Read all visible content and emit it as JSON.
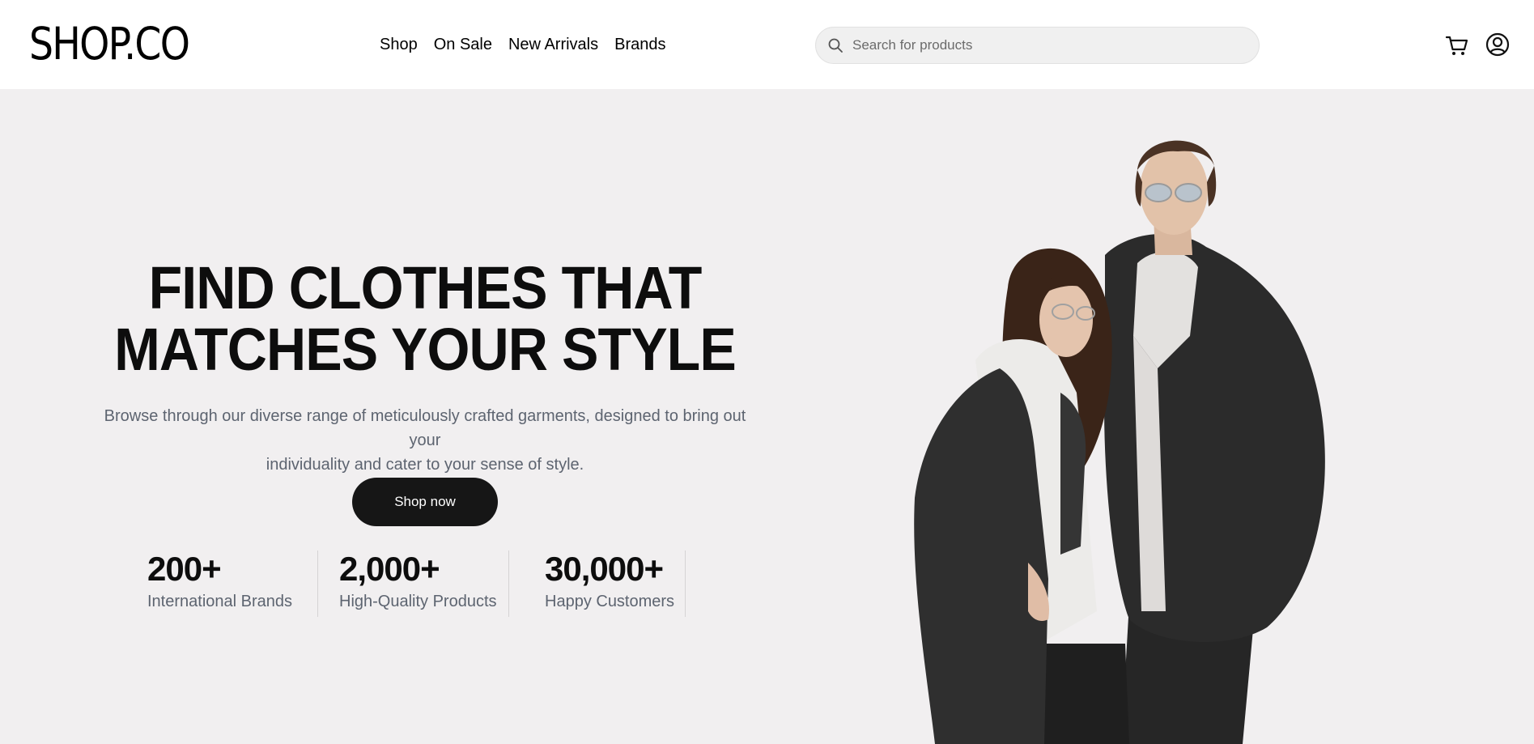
{
  "header": {
    "logo": "SHOP.CO",
    "nav": [
      "Shop",
      "On Sale",
      "New Arrivals",
      "Brands"
    ],
    "search_placeholder": "Search for products",
    "icons": [
      "search-icon",
      "cart-icon",
      "user-icon"
    ]
  },
  "hero": {
    "headline_line1": "FIND CLOTHES THAT",
    "headline_line2": "MATCHES YOUR STYLE",
    "subtitle_line1": "Browse through our diverse range of meticulously crafted garments, designed to bring out your",
    "subtitle_line2": "individuality and cater to your sense of style.",
    "cta_label": "Shop now",
    "stats": [
      {
        "value": "200+",
        "label": "International Brands"
      },
      {
        "value": "2,000+",
        "label": "High-Quality Products"
      },
      {
        "value": "30,000+",
        "label": "Happy Customers"
      }
    ]
  },
  "colors": {
    "hero_background": "#f1eff0",
    "button_background": "#161616",
    "muted_text": "#5d6470"
  }
}
